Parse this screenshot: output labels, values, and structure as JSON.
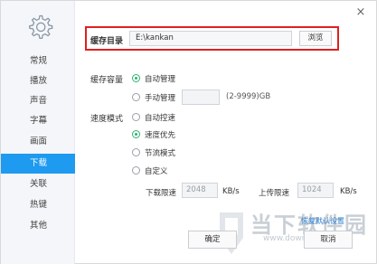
{
  "window": {
    "close_glyph": "×"
  },
  "sidebar": {
    "icon": "gear-icon",
    "items": [
      {
        "label": "常规"
      },
      {
        "label": "播放"
      },
      {
        "label": "声音"
      },
      {
        "label": "字幕"
      },
      {
        "label": "画面"
      },
      {
        "label": "下载",
        "active": true
      },
      {
        "label": "关联"
      },
      {
        "label": "热键"
      },
      {
        "label": "其他"
      }
    ]
  },
  "cache_dir": {
    "label": "缓存目录",
    "value": "E:\\kankan",
    "browse_label": "浏览"
  },
  "cache_size": {
    "label": "缓存容量",
    "auto_label": "自动管理",
    "manual_label": "手动管理",
    "manual_value": "",
    "range_label": "(2-9999)GB"
  },
  "speed_mode": {
    "label": "速度模式",
    "options": [
      "自动控速",
      "速度优先",
      "节流模式",
      "自定义"
    ],
    "selected": "速度优先",
    "download_limit_label": "下载限速",
    "download_limit_value": "2048",
    "download_unit": "KB/s",
    "upload_limit_label": "上传限速",
    "upload_limit_value": "1024",
    "upload_unit": "KB/s"
  },
  "footer": {
    "restore_label": "恢复默认设置",
    "ok_label": "确定",
    "cancel_label": "取消"
  },
  "watermark": {
    "text": "当下软件园",
    "url": "www.downxia.com"
  },
  "colors": {
    "accent": "#1e9af0",
    "radio_checked": "#2eb36f",
    "highlight_border": "#e02020"
  }
}
